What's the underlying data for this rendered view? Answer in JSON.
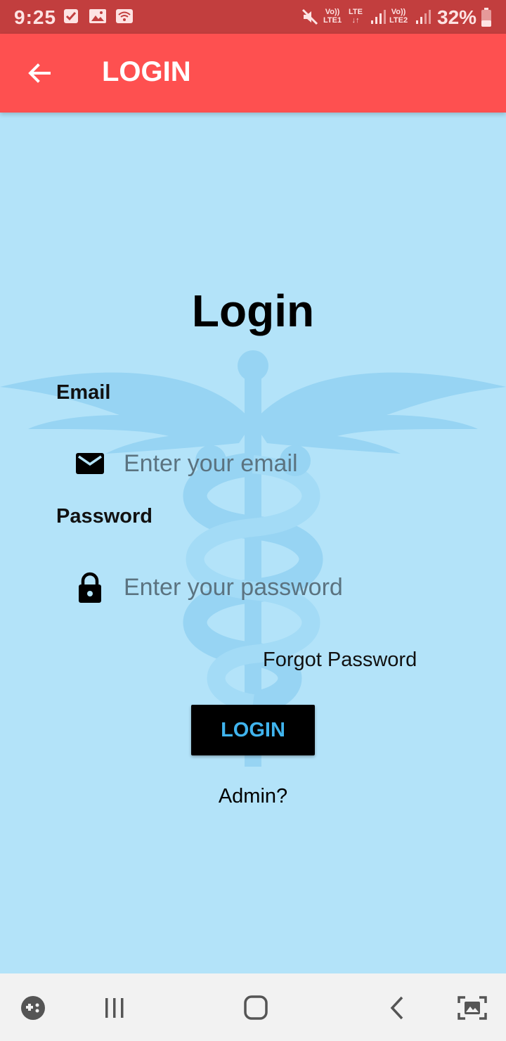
{
  "status_bar": {
    "time": "9:25",
    "battery": "32%",
    "net1_top": "Vo))",
    "net1_bottom": "LTE1",
    "net2_top": "LTE",
    "net2_bottom": "↓↑",
    "net3_top": "Vo))",
    "net3_bottom": "LTE2"
  },
  "app_bar": {
    "title": "LOGIN"
  },
  "form": {
    "heading": "Login",
    "email_label": "Email",
    "email_placeholder": "Enter your email",
    "email_value": "",
    "password_label": "Password",
    "password_placeholder": "Enter your password",
    "password_value": "",
    "forgot_label": "Forgot Password",
    "login_label": "LOGIN",
    "admin_label": "Admin?"
  },
  "colors": {
    "status_bar": "#c23e3e",
    "app_bar": "#fe5050",
    "background": "#b3e3f9",
    "button_text": "#40b4ee"
  }
}
